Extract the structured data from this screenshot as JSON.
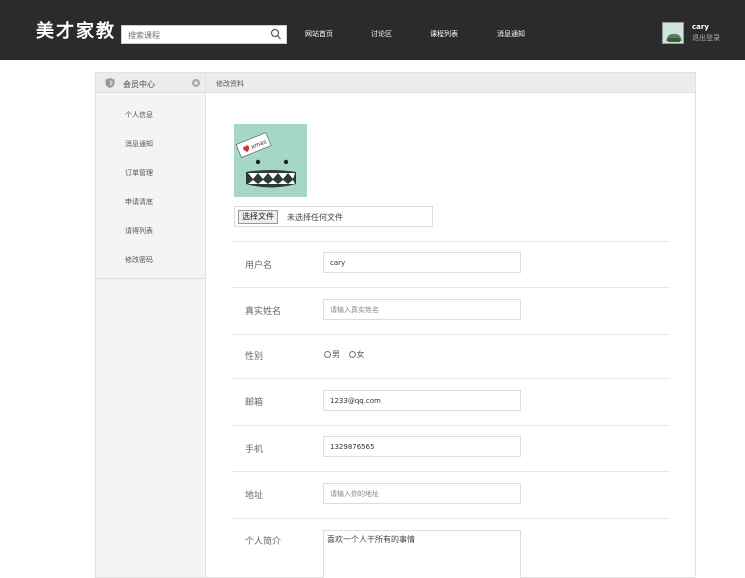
{
  "header": {
    "logo": "美才家教",
    "search_placeholder": "搜索课程",
    "nav": [
      "网站首页",
      "讨论区",
      "课程列表",
      "消息通知"
    ],
    "user_name": "cary",
    "logout": "退出登录"
  },
  "sidebar": {
    "title": "会员中心",
    "items": [
      "个人信息",
      "消息通知",
      "订单管理",
      "申请清底",
      "请得列表",
      "修改密码"
    ]
  },
  "main": {
    "title": "修改资料",
    "avatar_text": "xmas",
    "file_button": "选择文件",
    "file_status": "未选择任何文件",
    "fields": {
      "username": {
        "label": "用户名",
        "value": "cary"
      },
      "realname": {
        "label": "真实姓名",
        "placeholder": "请输入真实姓名"
      },
      "gender": {
        "label": "性别",
        "options": [
          "男",
          "女"
        ]
      },
      "email": {
        "label": "邮箱",
        "value": "1233@qq.com"
      },
      "phone": {
        "label": "手机",
        "value": "1329876565"
      },
      "address": {
        "label": "地址",
        "placeholder": "请输入你的地址"
      },
      "bio": {
        "label": "个人简介",
        "value": "喜欢一个人干所有的事情"
      }
    }
  }
}
